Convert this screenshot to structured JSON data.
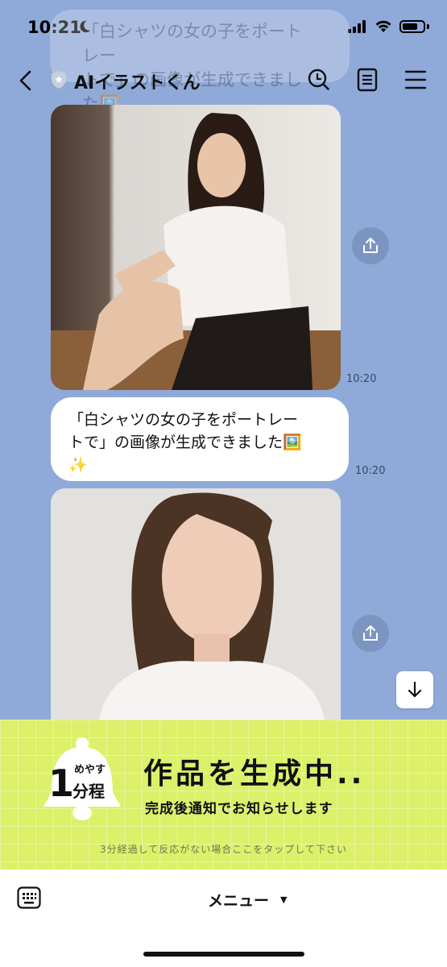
{
  "status_bar": {
    "time": "10:21"
  },
  "ghost_bubble": {
    "line1": "「白シャツの女の子をポートレー",
    "line2": "トで」の画像が生成できました🖼️"
  },
  "header": {
    "title": "AIイラストくん"
  },
  "messages": [
    {
      "type": "image",
      "desc": "woman-white-shirt-sitting",
      "time": "10:20"
    },
    {
      "type": "text",
      "line1": "「白シャツの女の子をポートレー",
      "line2": "トで」の画像が生成できました🖼️",
      "line3": "✨",
      "time": "10:20"
    },
    {
      "type": "image",
      "desc": "woman-portrait-closeup"
    }
  ],
  "banner": {
    "estimate_prefix": "めやす",
    "estimate_number": "1",
    "estimate_unit": "分程",
    "title": "作品を生成中..",
    "subtitle": "完成後通知でお知らせします",
    "note": "3分経過して反応がない場合ここをタップして下さい"
  },
  "bottom_bar": {
    "menu_label": "メニュー"
  },
  "icons": [
    "moon-icon",
    "signal-icon",
    "wifi-icon",
    "battery-icon",
    "back-icon",
    "shield-icon",
    "search-icon",
    "notes-icon",
    "menu-icon",
    "share-icon",
    "chevron-down-icon",
    "bell-icon",
    "keyboard-icon"
  ],
  "colors": {
    "chat_bg": "#8fa9d8",
    "banner_bg": "#dcf06a",
    "bubble": "#ffffff"
  }
}
